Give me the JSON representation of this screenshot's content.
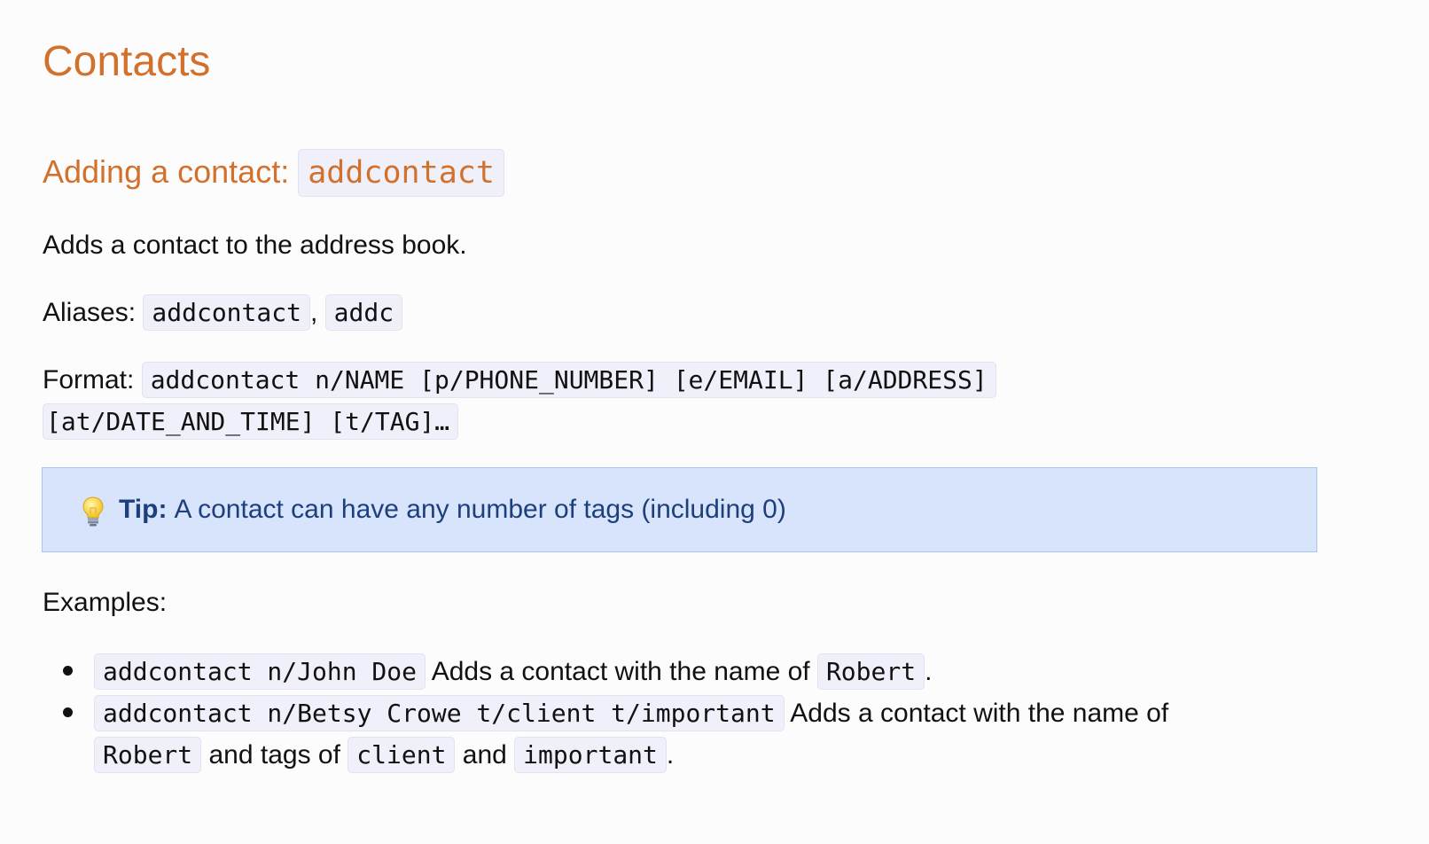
{
  "page_title": "Contacts",
  "section": {
    "heading_text": "Adding a contact: ",
    "heading_code": "addcontact"
  },
  "description": "Adds a contact to the address book.",
  "aliases": {
    "label": "Aliases: ",
    "items": [
      "addcontact",
      "addc"
    ],
    "separator": ", "
  },
  "format": {
    "label": "Format: ",
    "code_line1": "addcontact n/NAME [p/PHONE_NUMBER] [e/EMAIL] [a/ADDRESS]",
    "code_line2": "[at/DATE_AND_TIME] [t/TAG]…"
  },
  "tip": {
    "icon": "lightbulb-icon",
    "label": "Tip:",
    "text": "A contact can have any number of tags (including 0)"
  },
  "examples": {
    "label": "Examples:",
    "items": [
      {
        "code": "addcontact n/John Doe",
        "text": " Adds a contact with the name of ",
        "name_code": "Robert",
        "end": "."
      },
      {
        "code": "addcontact n/Betsy Crowe t/client t/important",
        "text": " Adds a contact with the name of ",
        "name_code": "Robert",
        "mid": " and tags of ",
        "tag1": "client",
        "and": " and ",
        "tag2": "important",
        "end": "."
      }
    ]
  },
  "colors": {
    "heading": "#d2712c",
    "tip_bg": "#d7e4fb",
    "tip_text": "#1d3f7c",
    "code_bg": "#eff0fa"
  }
}
